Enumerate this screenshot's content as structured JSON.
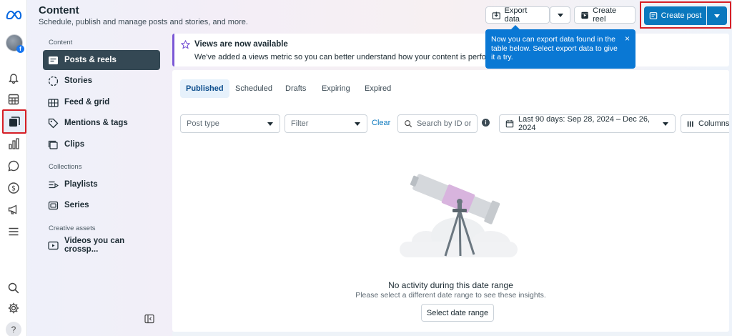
{
  "header": {
    "title": "Content",
    "subtitle": "Schedule, publish and manage posts and stories, and more.",
    "export_label": "Export data",
    "create_reel_label": "Create reel",
    "create_post_label": "Create post"
  },
  "tooltip": {
    "text": "Now you can export data found in the table below. Select export data to give it a try.",
    "close": "×"
  },
  "nav": {
    "content_heading": "Content",
    "items": [
      {
        "label": "Posts & reels",
        "icon": "posts-icon"
      },
      {
        "label": "Stories",
        "icon": "stories-icon"
      },
      {
        "label": "Feed & grid",
        "icon": "feed-grid-icon"
      },
      {
        "label": "Mentions & tags",
        "icon": "tag-icon"
      },
      {
        "label": "Clips",
        "icon": "clips-icon"
      }
    ],
    "collections_heading": "Collections",
    "collection_items": [
      {
        "label": "Playlists",
        "icon": "playlist-icon"
      },
      {
        "label": "Series",
        "icon": "series-icon"
      }
    ],
    "creative_heading": "Creative assets",
    "creative_items": [
      {
        "label": "Videos you can crossp...",
        "icon": "video-icon"
      }
    ]
  },
  "banner": {
    "title": "Views are now available",
    "text": "We've added a views metric so you can better understand how your content is performing on F"
  },
  "tabs": [
    "Published",
    "Scheduled",
    "Drafts",
    "Expiring",
    "Expired"
  ],
  "filters": {
    "post_type_placeholder": "Post type",
    "filter_placeholder": "Filter",
    "clear_label": "Clear",
    "search_placeholder": "Search by ID or cap",
    "info": "i",
    "date_range": "Last 90 days: Sep 28, 2024 – Dec 26, 2024",
    "columns_label": "Columns"
  },
  "empty_state": {
    "title": "No activity during this date range",
    "subtitle": "Please select a different date range to see these insights.",
    "button": "Select date range"
  },
  "rail": {
    "help": "?",
    "avatar_badge": "f"
  },
  "colors": {
    "accent": "#0a78be",
    "nav_selected": "#344854",
    "banner_accent": "#7b58d6",
    "highlight_box": "#d61f26"
  }
}
